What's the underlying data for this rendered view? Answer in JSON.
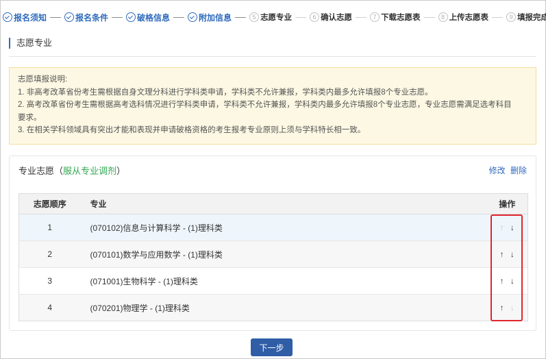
{
  "steps": [
    {
      "label": "报名须知",
      "num": "",
      "state": "done"
    },
    {
      "label": "报名条件",
      "num": "",
      "state": "done"
    },
    {
      "label": "破格信息",
      "num": "",
      "state": "done"
    },
    {
      "label": "附加信息",
      "num": "",
      "state": "done"
    },
    {
      "label": "志愿专业",
      "num": "5",
      "state": "pending"
    },
    {
      "label": "确认志愿",
      "num": "6",
      "state": "pending"
    },
    {
      "label": "下载志愿表",
      "num": "7",
      "state": "pending"
    },
    {
      "label": "上传志愿表",
      "num": "8",
      "state": "pending"
    },
    {
      "label": "填报完成",
      "num": "9",
      "state": "pending"
    }
  ],
  "section_title": "志愿专业",
  "notice": {
    "title": "志愿填报说明:",
    "line1": "1. 非高考改革省份考生需根据自身文理分科进行学科类申请，学科类不允许兼报，学科类内最多允许填报8个专业志愿。",
    "line2a": "2. 高考改革省份考生需根据高考选科情况进行学科类申请，学科类不允许兼报，学科类内最多允许填报8个专业志愿，专业志愿需满足选考科目",
    "line2b": "要求。",
    "line3": "3. 在相关学科领域具有突出才能和表现并申请破格资格的考生报考专业原则上须与学科特长相一致。"
  },
  "panel": {
    "title_prefix": "专业志愿（",
    "title_green": "服从专业调剂",
    "title_suffix": "）",
    "edit": "修改",
    "delete": "删除"
  },
  "table": {
    "headers": {
      "order": "志愿顺序",
      "major": "专业",
      "ops": "操作"
    },
    "rows": [
      {
        "order": "1",
        "major": "(070102)信息与计算科学 - (1)理科类"
      },
      {
        "order": "2",
        "major": "(070101)数学与应用数学 - (1)理科类"
      },
      {
        "order": "3",
        "major": "(071001)生物科学 - (1)理科类"
      },
      {
        "order": "4",
        "major": "(070201)物理学 - (1)理科类"
      }
    ],
    "up_arrow": "↑",
    "down_arrow": "↓"
  },
  "next_button": "下一步",
  "colors": {
    "accent": "#2f6bbd",
    "green": "#32a852",
    "highlight": "#e0242b",
    "button": "#2f5ea7"
  }
}
